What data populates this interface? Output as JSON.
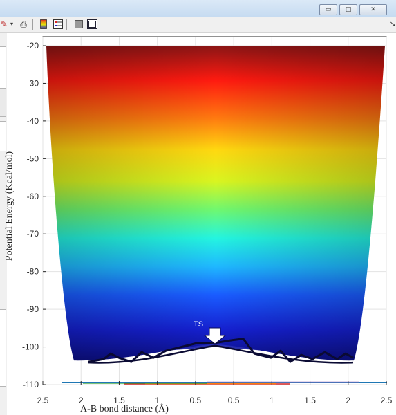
{
  "window": {
    "minimize_glyph": "▭",
    "maximize_glyph": "□",
    "close_glyph": "✕"
  },
  "toolbar": {
    "icons": [
      "brush-icon",
      "dropdown-arrow-icon",
      "print-preview-icon",
      "colorbar-icon",
      "legend-icon",
      "hide-tools-icon",
      "dock-icon"
    ],
    "overflow_glyph": "↘"
  },
  "chart_data": {
    "type": "area",
    "title": "",
    "xlabel": "A-B bond distance (Å)",
    "ylabel": "Potential Energy (Kcal/mol)",
    "x_tick_labels": [
      "2.5",
      "2",
      "1.5",
      "1",
      "0.5",
      "0.5",
      "1",
      "1.5",
      "2",
      "2.5"
    ],
    "y_ticks": [
      -20,
      -30,
      -40,
      -50,
      -60,
      -70,
      -80,
      -90,
      -100,
      -110
    ],
    "ylim": [
      -110,
      -20
    ],
    "grid": true,
    "colormap": "jet",
    "annotation": {
      "text": "TS",
      "marker": "arrow-down"
    },
    "ts_energy": -99.3,
    "well_energy": -103.6,
    "colors": {
      "high": "#c0201c",
      "low": "#11168a",
      "path": "#0a0a33"
    }
  }
}
